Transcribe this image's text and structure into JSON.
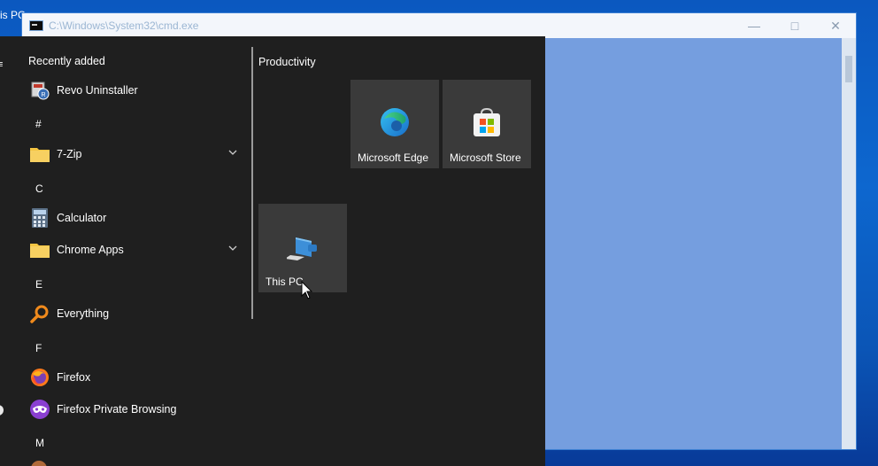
{
  "desktop": {
    "label": "is PC"
  },
  "cmd_window": {
    "title": "C:\\Windows\\System32\\cmd.exe",
    "minimize_icon": "minimize-icon",
    "maximize_icon": "maximize-icon",
    "close_icon": "close-icon"
  },
  "start_menu": {
    "app_list": {
      "recently_added_label": "Recently added",
      "items": [
        {
          "label": "Revo Uninstaller",
          "icon": "revo-uninstaller-icon"
        },
        {
          "letter": "#"
        },
        {
          "label": "7-Zip",
          "icon": "folder-icon",
          "expandable": true
        },
        {
          "letter": "C"
        },
        {
          "label": "Calculator",
          "icon": "calculator-icon"
        },
        {
          "label": "Chrome Apps",
          "icon": "folder-icon",
          "expandable": true
        },
        {
          "letter": "E"
        },
        {
          "label": "Everything",
          "icon": "search-icon"
        },
        {
          "letter": "F"
        },
        {
          "label": "Firefox",
          "icon": "firefox-icon"
        },
        {
          "label": "Firefox Private Browsing",
          "icon": "private-browsing-icon"
        },
        {
          "letter": "M"
        }
      ]
    },
    "tiles": {
      "group_title": "Productivity",
      "items": [
        {
          "label": "Microsoft Edge",
          "icon": "edge-icon"
        },
        {
          "label": "Microsoft Store",
          "icon": "store-icon"
        },
        {
          "label": "This PC",
          "icon": "this-pc-icon"
        }
      ]
    }
  },
  "colors": {
    "start_bg": "#1f1f1f",
    "tile_bg": "#3a3a3a",
    "folder": "#f4c542",
    "desktop_blue": "#0b58bf"
  }
}
